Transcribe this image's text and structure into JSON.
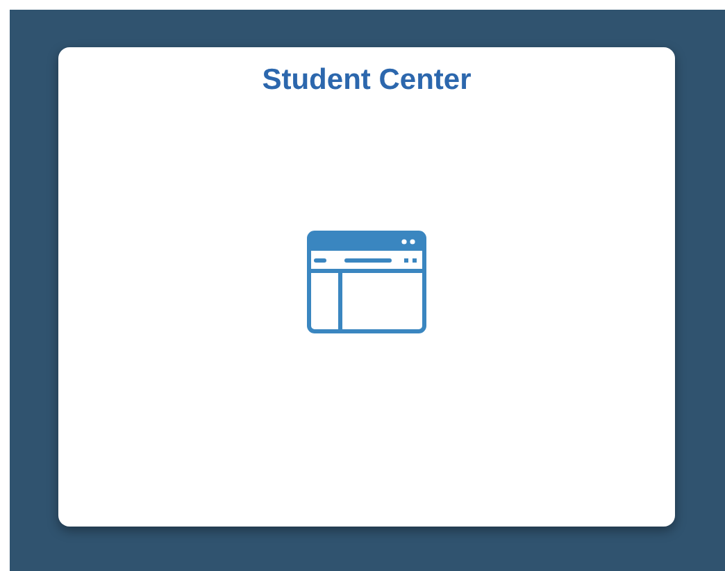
{
  "tile": {
    "title": "Student Center"
  }
}
